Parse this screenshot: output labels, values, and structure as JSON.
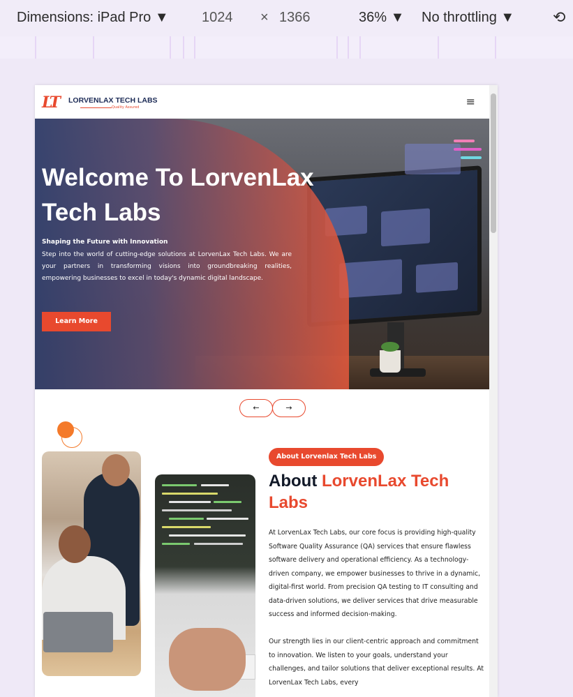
{
  "devtools": {
    "dimensions_label": "Dimensions: iPad Pro ▼",
    "width": "1024",
    "times": "×",
    "height": "1366",
    "zoom": "36% ▼",
    "throttling": "No throttling ▼",
    "rotate_icon": "⟲"
  },
  "site": {
    "logo_mark": "LT",
    "logo_name": "LORVENLAX TECH LABS",
    "logo_tagline": "Quality Assured",
    "menu_icon": "≡"
  },
  "hero": {
    "title": "Welcome To LorvenLax Tech Labs",
    "subtitle": "Shaping the Future with Innovation",
    "description": "Step into the world of cutting-edge solutions at LorvenLax Tech Labs. We are your partners in transforming visions into groundbreaking realities, empowering businesses to excel in today's dynamic digital landscape.",
    "cta": "Learn More"
  },
  "carousel": {
    "prev": "←",
    "next": "→"
  },
  "about": {
    "badge": "About Lorvenlax Tech Labs",
    "title_dark": "About",
    "title_accent": "LorvenLax Tech Labs",
    "paragraph1": "At LorvenLax Tech Labs, our core focus is providing high-quality Software Quality Assurance (QA) services that ensure flawless software delivery and operational efficiency. As a technology-driven company, we empower businesses to thrive in a dynamic, digital-first world. From precision QA testing to IT consulting and data-driven solutions, we deliver services that drive measurable success and informed decision-making.",
    "paragraph2": "Our strength lies in our client-centric approach and commitment to innovation. We listen to your goals, understand your challenges, and tailor solutions that deliver exceptional results. At LorvenLax Tech Labs, every"
  },
  "colors": {
    "accent": "#e8492e",
    "navy": "#111827",
    "background": "#efe9f7"
  }
}
